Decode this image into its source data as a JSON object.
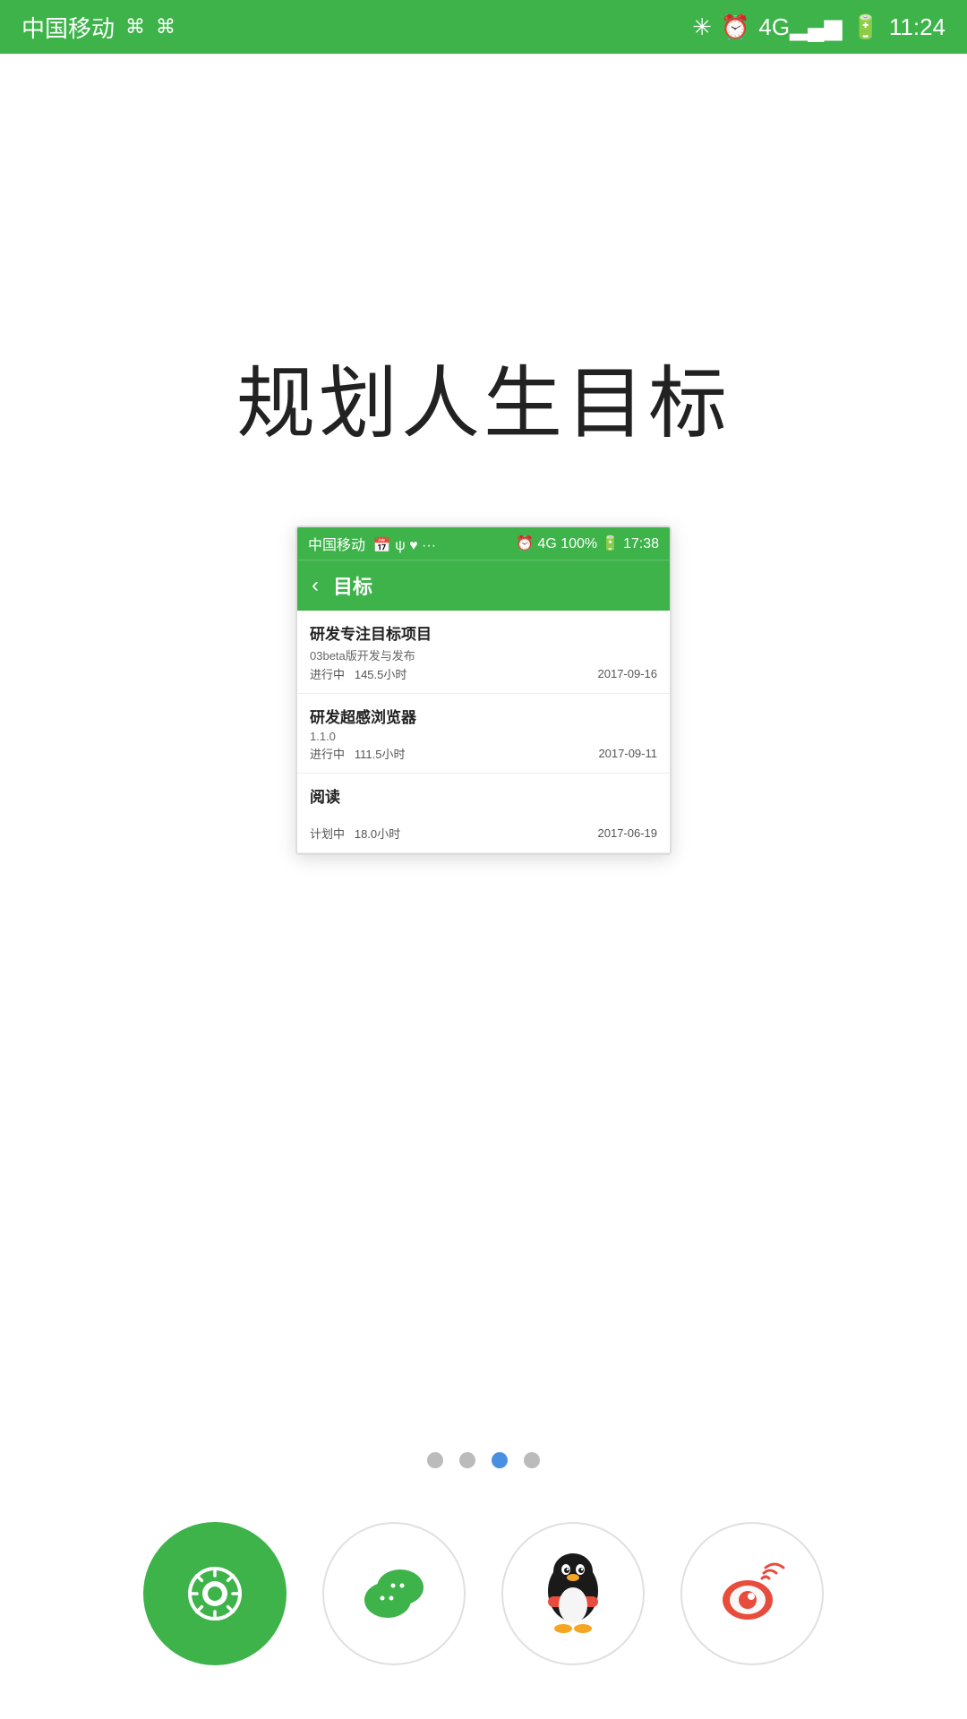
{
  "statusBar": {
    "carrier": "中国移动",
    "time": "11:24",
    "icons": [
      "bluetooth",
      "alarm",
      "4g",
      "signal",
      "battery"
    ]
  },
  "pageTitle": "规划人生目标",
  "screenshot": {
    "statusBar": {
      "left": "中国移动",
      "icons": "📅 ψ ♥ ...",
      "right": "🕐 4G 100% 17:38"
    },
    "header": {
      "backLabel": "‹",
      "title": "目标"
    },
    "items": [
      {
        "title": "研发专注目标项目",
        "subtitle": "03beta版开发与发布",
        "status": "进行中",
        "hours": "145.5小时",
        "date": "2017-09-16"
      },
      {
        "title": "研发超感浏览器",
        "subtitle": "1.1.0",
        "status": "进行中",
        "hours": "111.5小时",
        "date": "2017-09-11"
      },
      {
        "title": "阅读",
        "subtitle": "",
        "status": "计划中",
        "hours": "18.0小时",
        "date": "2017-06-19"
      }
    ]
  },
  "pagination": {
    "dots": [
      {
        "active": false
      },
      {
        "active": false
      },
      {
        "active": true
      },
      {
        "active": false
      }
    ]
  },
  "bottomIcons": [
    {
      "name": "app-icon",
      "type": "eye-camera",
      "label": "主应用"
    },
    {
      "name": "wechat-icon",
      "type": "wechat",
      "label": "微信"
    },
    {
      "name": "qq-icon",
      "type": "qq",
      "label": "QQ"
    },
    {
      "name": "weibo-icon",
      "type": "weibo",
      "label": "微博"
    }
  ]
}
